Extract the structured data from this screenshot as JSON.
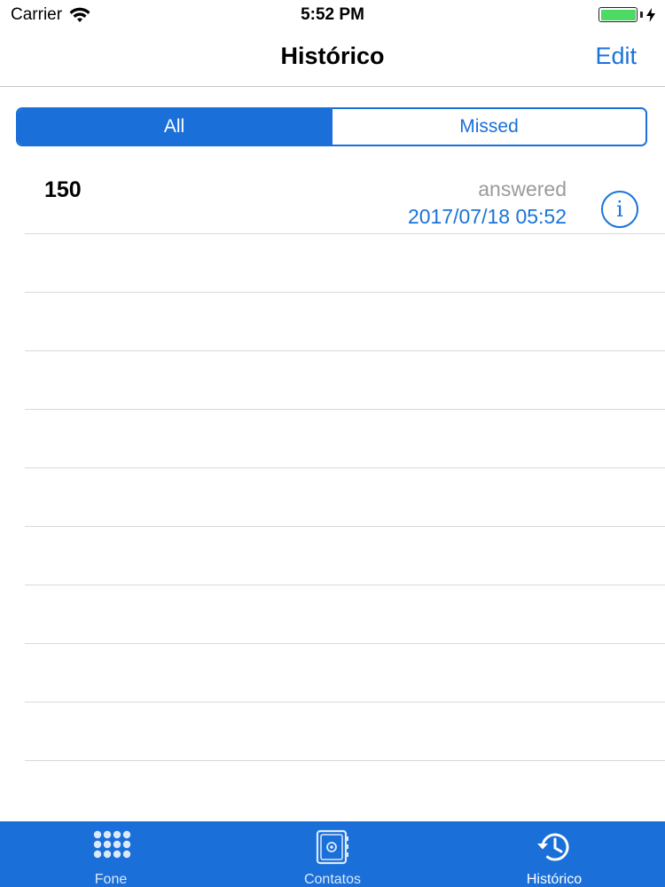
{
  "status_bar": {
    "carrier": "Carrier",
    "time": "5:52 PM"
  },
  "nav": {
    "title": "Histórico",
    "edit_label": "Edit"
  },
  "segments": {
    "all_label": "All",
    "missed_label": "Missed",
    "selected": "All"
  },
  "calls": [
    {
      "number": "150",
      "status": "answered",
      "datetime": "2017/07/18 05:52"
    }
  ],
  "tabs": [
    {
      "label": "Fone",
      "icon": "keypad-icon",
      "active": false
    },
    {
      "label": "Contatos",
      "icon": "contacts-book-icon",
      "active": false
    },
    {
      "label": "Histórico",
      "icon": "history-clock-icon",
      "active": true
    }
  ],
  "colors": {
    "accent": "#1a6fd8",
    "link": "#1a73d9",
    "status_gray": "#9b9b9f",
    "battery": "#4cd964"
  }
}
